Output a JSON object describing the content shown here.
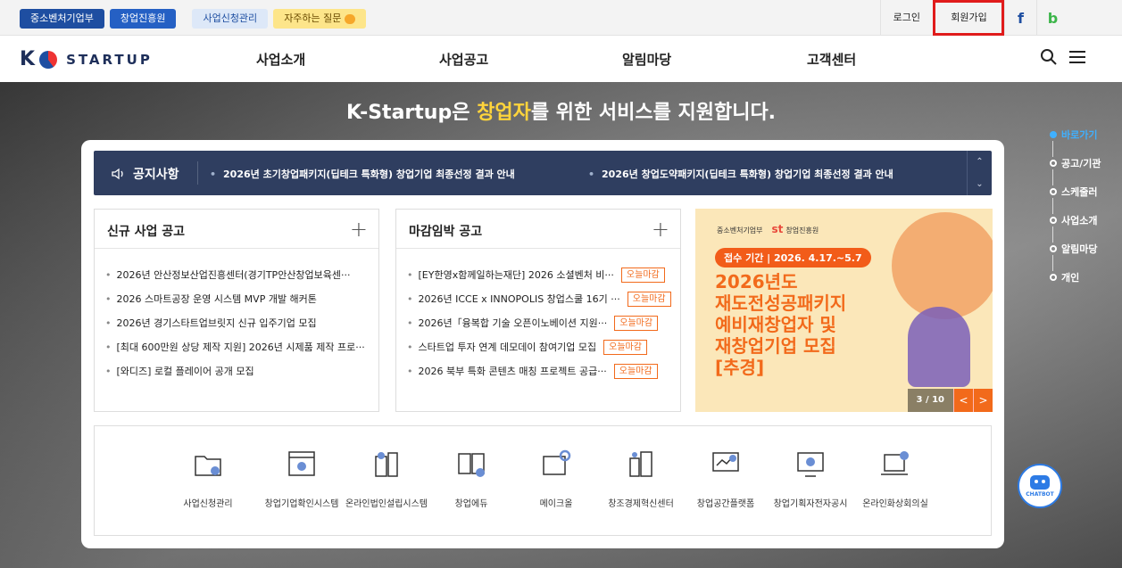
{
  "topbar": {
    "left_pills": [
      "중소벤처기업부",
      "창업진흥원"
    ],
    "biz_mgmt": "사업신청관리",
    "faq": "자주하는 질문",
    "login": "로그인",
    "signup": "회원가입",
    "facebook": "f",
    "blog": "b"
  },
  "header": {
    "logo_k": "K",
    "logo_text": "STARTUP",
    "nav": [
      "사업소개",
      "사업공고",
      "알림마당",
      "고객센터"
    ]
  },
  "hero": {
    "title_pre": "K-Startup은 ",
    "title_hl": "창업자",
    "title_post": "를 위한 서비스를 지원합니다."
  },
  "quicknav": [
    "바로가기",
    "공고/기관",
    "스케줄러",
    "사업소개",
    "알림마당",
    "개인"
  ],
  "chatbot": "CHATBOT",
  "notice": {
    "label": "공지사항",
    "items": [
      "2026년 초기창업패키지(딥테크 특화형) 창업기업 최종선정 결과 안내",
      "2026년 창업도약패키지(딥테크 특화형) 창업기업 최종선정 결과 안내"
    ]
  },
  "new_biz": {
    "title": "신규 사업 공고",
    "items": [
      "2026년 안산정보산업진흥센터(경기TP안산창업보육센···",
      "2026 스마트공장 운영 시스템 MVP 개발 해커톤",
      "2026년 경기스타트업브릿지 신규 입주기업 모집",
      "[최대 600만원 상당 제작 지원] 2026년 시제품 제작 프로···",
      "[와디즈] 로컬 플레이어 공개 모집"
    ]
  },
  "deadline": {
    "title": "마감임박 공고",
    "tag": "오늘마감",
    "items": [
      "[EY한영x함께일하는재단] 2026 소셜벤처 비···",
      "2026년 ICCE x INNOPOLIS 창업스쿨 16기 ···",
      "2026년「융복합 기술 오픈이노베이션 지원···",
      "스타트업 투자 연계 데모데이 참여기업 모집",
      "2026 북부 특화 콘텐츠 매칭 프로젝트 공급···"
    ]
  },
  "banner": {
    "org1": "중소벤처기업부",
    "org2": "창업진흥원",
    "date": "접수 기간 | 2026. 4.17.~5.7",
    "main": "2026년도\n재도전성공패키지\n예비재창업자 및\n재창업기업 모집\n[추경]",
    "counter": "3 / 10",
    "prev": "<",
    "next": ">"
  },
  "services": [
    "사업신청관리",
    "창업기업확인시스템",
    "온라인법인설립시스템",
    "창업에듀",
    "메이크올",
    "창조경제혁신센터",
    "창업공간플랫폼",
    "창업기획자전자공시",
    "온라인화상회의실"
  ],
  "colors": {
    "navy": "#2f3e60",
    "accent_orange": "#f26a1b",
    "signup_highlight": "#e01b1b",
    "brand_blue": "#1e4ea1"
  }
}
